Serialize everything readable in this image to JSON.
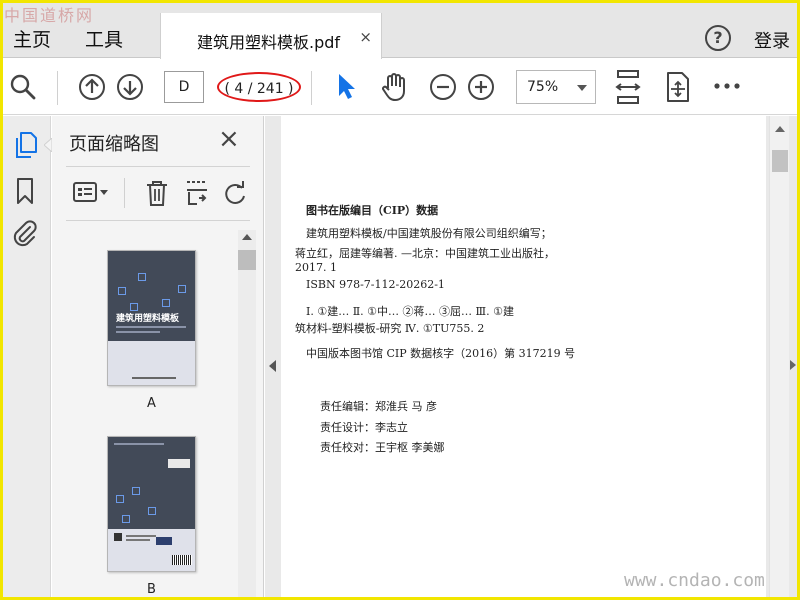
{
  "watermark_top": "中国道桥网",
  "watermark_bottom": "www.cndao.com",
  "nav": {
    "home": "主页",
    "tools": "工具"
  },
  "tab": {
    "title": "建筑用塑料模板.pdf",
    "close": "×"
  },
  "header_right": {
    "help": "?",
    "login": "登录"
  },
  "toolbar": {
    "page_input": "D",
    "page_count": "( 4 / 241 )",
    "zoom": "75%",
    "icons": [
      "search-icon",
      "page-up-icon",
      "page-down-icon",
      "select-cursor-icon",
      "hand-tool-icon",
      "zoom-out-icon",
      "zoom-in-icon",
      "fit-page-icon",
      "rotate-view-icon",
      "more-icon"
    ]
  },
  "rail": {
    "icons": [
      "pages-icon",
      "bookmark-icon",
      "attachment-icon"
    ]
  },
  "panel": {
    "title": "页面缩略图",
    "close": "×",
    "thumbnails": [
      {
        "label": "A",
        "cover_title": "建筑用塑料模板"
      },
      {
        "label": "B"
      }
    ]
  },
  "document": {
    "heading": "图书在版编目（CIP）数据",
    "lines": [
      "建筑用塑料模板/中国建筑股份有限公司组织编写；",
      "蒋立红，屈建等编著.  —北京：中国建筑工业出版社，",
      "2017. 1",
      "ISBN 978-7-112-20262-1",
      "Ⅰ. ①建…   Ⅱ. ①中… ②蒋… ③屈…   Ⅲ. ①建",
      "筑材料-塑料模板-研究   Ⅳ. ①TU755. 2",
      "中国版本图书馆 CIP 数据核字（2016）第 317219 号"
    ],
    "credits": [
      "责任编辑：郑淮兵    马    彦",
      "责任设计：李志立",
      "责任校对：王宇枢    李美娜"
    ]
  },
  "colors": {
    "accent": "#1473e6",
    "highlight_circle": "#e01818",
    "frame": "#f2e600"
  }
}
